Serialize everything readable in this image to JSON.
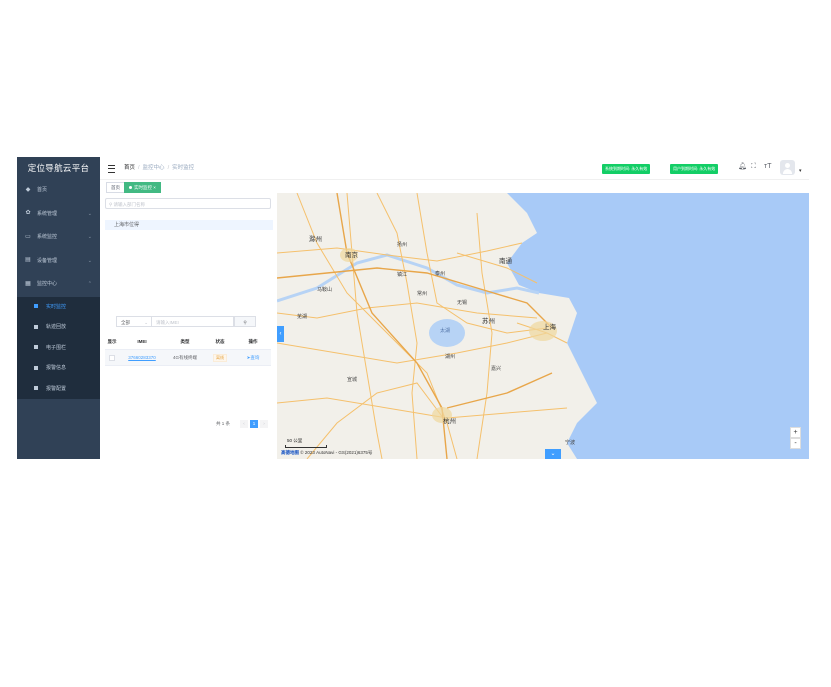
{
  "app_title": "定位导航云平台",
  "menu": [
    {
      "label": "首页",
      "icon": "dashboard-icon"
    },
    {
      "label": "系统管理",
      "icon": "gear-icon",
      "expandable": true
    },
    {
      "label": "系统监控",
      "icon": "monitor-icon",
      "expandable": true
    },
    {
      "label": "设备管理",
      "icon": "device-icon",
      "expandable": true
    },
    {
      "label": "监控中心",
      "icon": "grid-icon",
      "expandable": true
    }
  ],
  "submenu": [
    {
      "label": "实时监控",
      "active": true
    },
    {
      "label": "轨迹回放"
    },
    {
      "label": "电子围栏"
    },
    {
      "label": "报警信息"
    },
    {
      "label": "报警配置"
    }
  ],
  "breadcrumb": {
    "home": "首页",
    "section": "监控中心",
    "current": "实时监控"
  },
  "header_buttons": {
    "system_expiry": "系统到期时间: 永久有效",
    "user_expiry": "用户到期时间: 永久有效"
  },
  "tags": {
    "home": "首页",
    "active": "实时监控",
    "close": "×"
  },
  "panel": {
    "search_placeholder": "请输入部门名称",
    "tree_node": "上海市位得",
    "filter_select": "全部",
    "filter_placeholder": "请输入IMEI",
    "table_headers": [
      "显示",
      "IMEI",
      "类型",
      "状态",
      "操作"
    ],
    "rows": [
      {
        "imei": "37660283370",
        "type": "4G有线终端",
        "status": "离线",
        "action": "查询"
      }
    ],
    "pager_total": "共 1 条",
    "pager_page": "1"
  },
  "map": {
    "labels": [
      {
        "text": "滁州",
        "big": true
      },
      {
        "text": "马鞍山"
      },
      {
        "text": "南京",
        "big": true
      },
      {
        "text": "扬州"
      },
      {
        "text": "泰州"
      },
      {
        "text": "南通",
        "big": true
      },
      {
        "text": "常州"
      },
      {
        "text": "无锡"
      },
      {
        "text": "苏州",
        "big": true
      },
      {
        "text": "上海",
        "big": true
      },
      {
        "text": "湖州"
      },
      {
        "text": "嘉兴"
      },
      {
        "text": "杭州",
        "big": true
      },
      {
        "text": "宁波"
      },
      {
        "text": "太湖",
        "sea": true
      },
      {
        "text": "宣城"
      },
      {
        "text": "芜湖"
      },
      {
        "text": "镇江"
      }
    ],
    "scale": "50 公里",
    "copyright_logo": "高德地图",
    "copyright": "© 2023 AutoNavi - GS(2021)6375号",
    "zoom_in": "+",
    "zoom_out": "-",
    "colors": {
      "land": "#f2f0ea",
      "sea": "#a8caf7",
      "lake": "#b7d3f5",
      "road": "#f5c06c",
      "primary": "#409eff",
      "success": "#13ce66",
      "sidebar": "#304156"
    }
  }
}
